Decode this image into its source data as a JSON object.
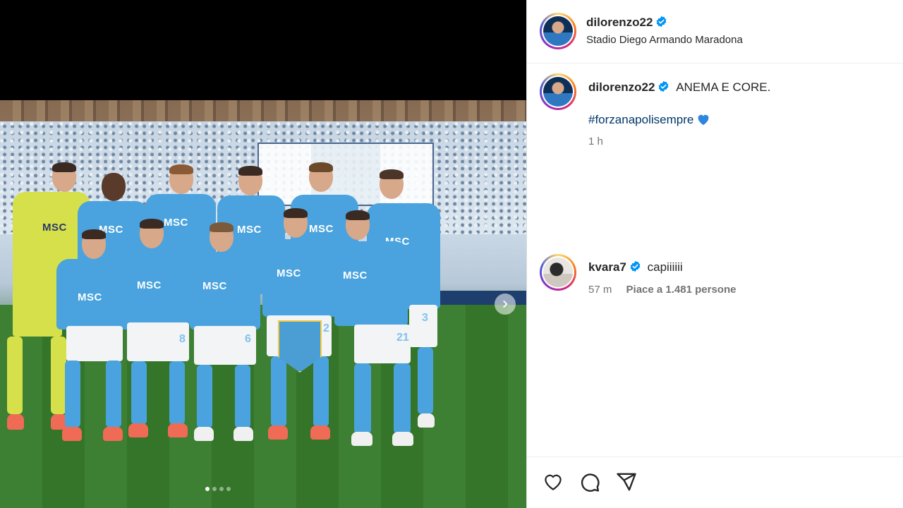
{
  "post": {
    "username": "dilorenzo22",
    "location": "Stadio Diego Armando Maradona",
    "caption_username": "dilorenzo22",
    "caption_text": "ANEMA E CORE.",
    "hashtag": "#forzanapolisempre",
    "caption_time": "1 h"
  },
  "media": {
    "sponsor_text": "MSC",
    "shirt_numbers": [
      "8",
      "6",
      "2",
      "21",
      "3"
    ],
    "carousel_slide_count": 4,
    "carousel_active_index": 0
  },
  "comment": {
    "username": "kvara7",
    "text": "capiiiiii",
    "time": "57 m",
    "likes": "Piace a 1.481 persone"
  },
  "colors": {
    "verified": "#0095f6",
    "hashtag": "#00376b",
    "kit": "#4aa3de",
    "keeper_kit": "#d6e04a"
  },
  "icons": [
    "verified-badge-icon",
    "blue-heart-icon",
    "like-icon",
    "comment-icon",
    "share-icon",
    "next-arrow-icon"
  ]
}
